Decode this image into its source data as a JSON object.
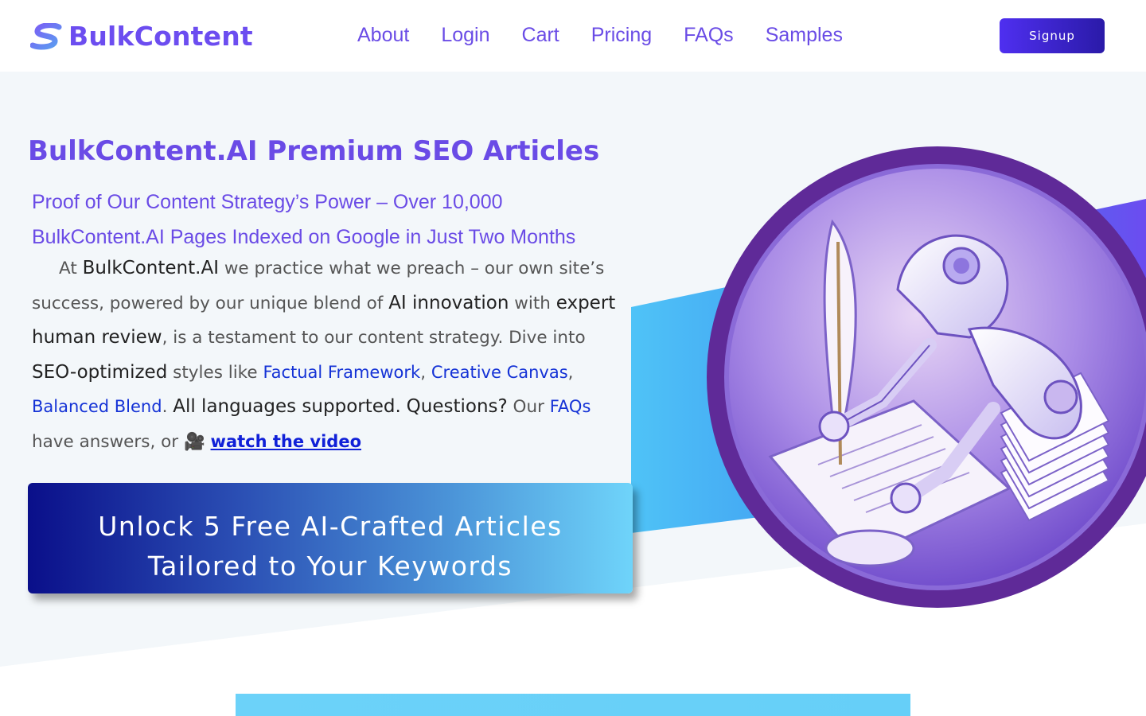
{
  "brand": {
    "name": "BulkContent",
    "accent": "#6c4df0"
  },
  "nav": {
    "items": [
      {
        "label": "About"
      },
      {
        "label": "Login"
      },
      {
        "label": "Cart"
      },
      {
        "label": "Pricing"
      },
      {
        "label": "FAQs"
      },
      {
        "label": "Samples"
      }
    ],
    "signup_label": "Signup"
  },
  "hero": {
    "title": "BulkContent.AI Premium SEO Articles",
    "subtitle": "Proof of Our Content Strategy’s Power – Over 10,000 BulkContent.AI Pages Indexed on Google in Just Two Months",
    "body": {
      "t1": "At ",
      "s1": "BulkContent.AI",
      "t2": " we practice what we preach – our own site’s success, powered by our unique blend of ",
      "s2": "AI innovation",
      "t3": " with ",
      "s3": "expert human review",
      "t4": ", is a testament to our content strategy. Dive into ",
      "s4": "SEO-optimized",
      "t5": " styles like ",
      "link1": "Factual Framework",
      "t6": ", ",
      "link2": "Creative Canvas",
      "t7": ", ",
      "link3": "Balanced Blend",
      "t8": ". ",
      "s5": "All languages supported.",
      "t9": " ",
      "s6": "Questions?",
      "t10": " Our ",
      "link4": "FAQs",
      "t11": " have answers, or 🎥 ",
      "video_link": "watch the video"
    },
    "cta_line1": "Unlock 5 Free AI-Crafted Articles",
    "cta_line2": "Tailored to Your Keywords"
  },
  "colors": {
    "cta_start": "#0a0f8a",
    "cta_end": "#6fd4fa",
    "link": "#1432d6",
    "hero_bg": "#f3f7fa"
  }
}
